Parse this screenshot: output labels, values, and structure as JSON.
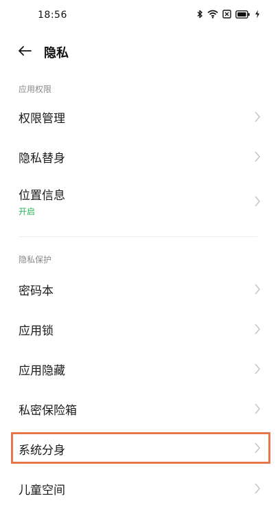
{
  "status": {
    "time": "18:56"
  },
  "header": {
    "title": "隐私"
  },
  "sections": [
    {
      "label": "应用权限",
      "items": [
        {
          "label": "权限管理"
        },
        {
          "label": "隐私替身"
        },
        {
          "label": "位置信息",
          "sub": "开启"
        }
      ]
    },
    {
      "label": "隐私保护",
      "items": [
        {
          "label": "密码本"
        },
        {
          "label": "应用锁"
        },
        {
          "label": "应用隐藏"
        },
        {
          "label": "私密保险箱"
        },
        {
          "label": "系统分身"
        },
        {
          "label": "儿童空间"
        }
      ]
    }
  ],
  "colors": {
    "accent_sub": "#2fb35a",
    "highlight_border": "#e8764b"
  }
}
